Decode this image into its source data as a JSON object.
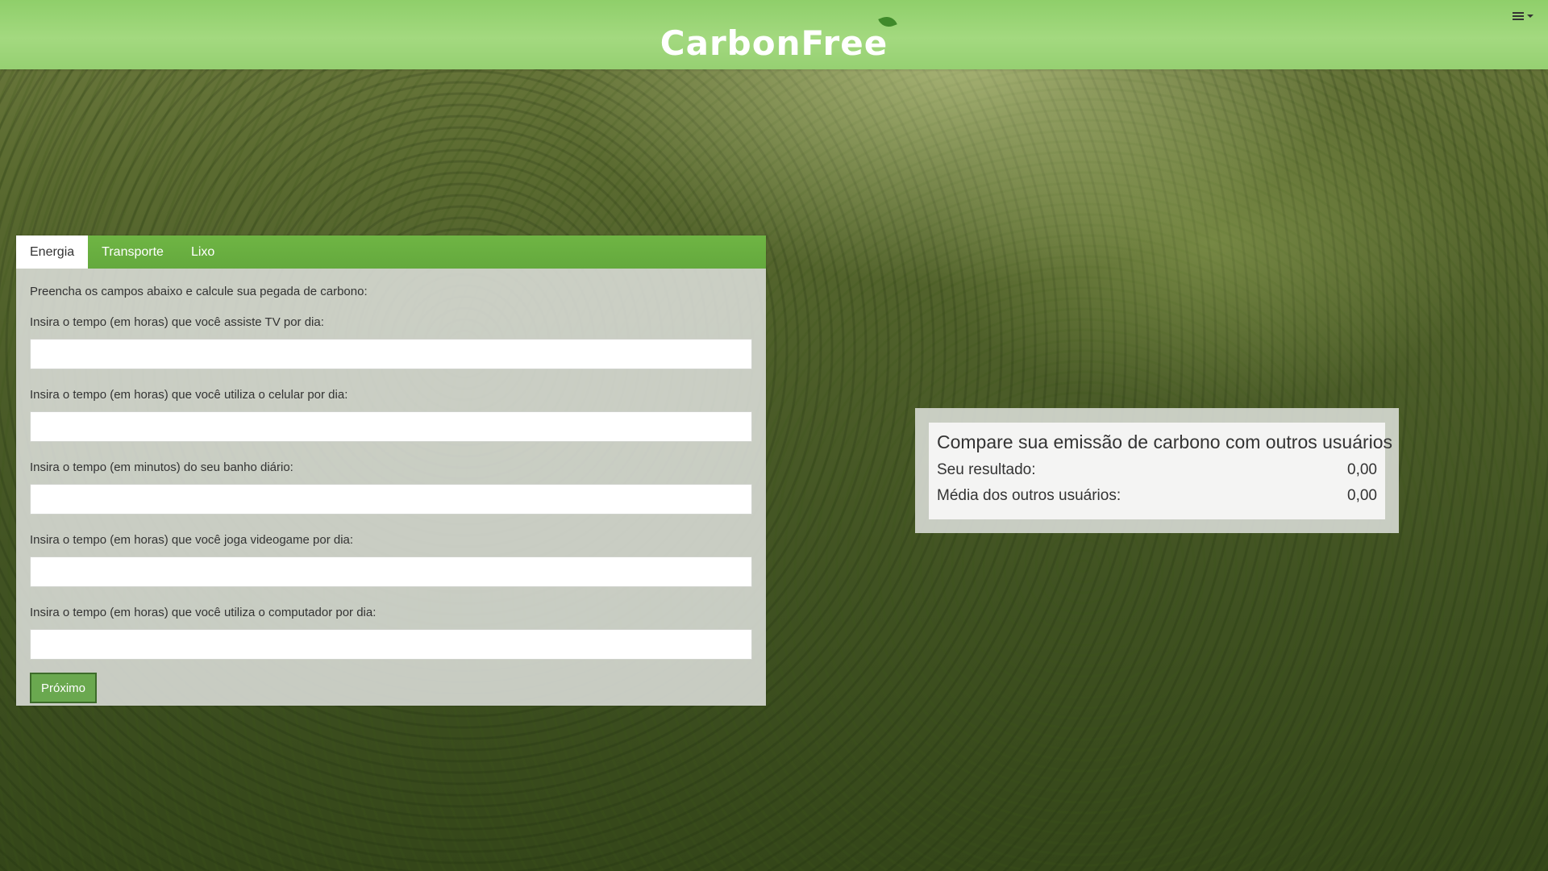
{
  "header": {
    "logo_text": "CarbonFree",
    "logo_icon": "leaf-icon",
    "menu_icon": "hamburger-menu-icon",
    "background_color": "#9ad576"
  },
  "tabs": [
    {
      "label": "Energia",
      "active": true
    },
    {
      "label": "Transporte",
      "active": false
    },
    {
      "label": "Lixo",
      "active": false
    }
  ],
  "form": {
    "intro": "Preencha os campos abaixo e calcule sua pegada de carbono:",
    "fields": [
      {
        "label": "Insira o tempo (em horas) que você assiste TV por dia:",
        "value": ""
      },
      {
        "label": "Insira o tempo (em horas) que você utiliza o celular por dia:",
        "value": ""
      },
      {
        "label": "Insira o tempo (em minutos) do seu banho diário:",
        "value": ""
      },
      {
        "label": "Insira o tempo (em horas) que você joga videogame por dia:",
        "value": ""
      },
      {
        "label": "Insira o tempo (em horas) que você utiliza o computador por dia:",
        "value": ""
      }
    ],
    "next_button": "Próximo",
    "accent_color": "#6aa84f"
  },
  "compare": {
    "title": "Compare sua emissão de carbono com outros usuários",
    "result_label": "Seu resultado:",
    "result_value": "0,00",
    "average_label": "Média dos outros usuários:",
    "average_value": "0,00"
  }
}
